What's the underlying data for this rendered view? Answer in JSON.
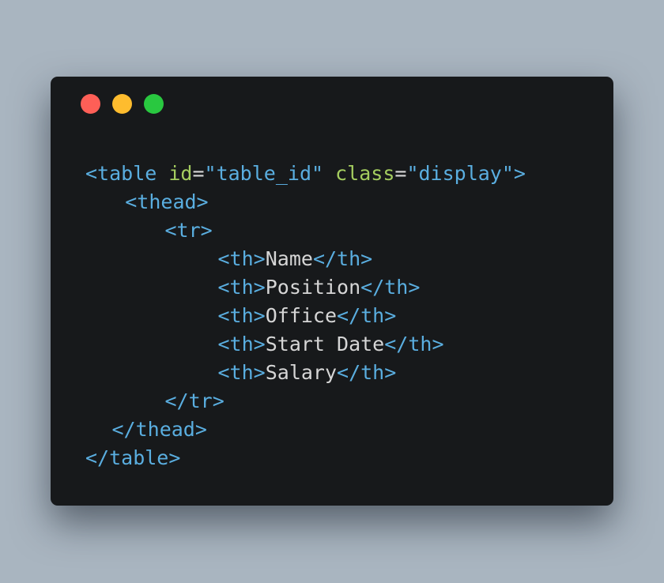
{
  "colors": {
    "close": "#fe5f57",
    "minimize": "#febc2e",
    "maximize": "#29c840",
    "tag": "#5aaee0",
    "attr": "#a4cd5f",
    "punct": "#d6d6d6",
    "string": "#5aaee0",
    "text": "#d6d6d6"
  },
  "code": {
    "lines": [
      {
        "indent": 0,
        "tokens": [
          {
            "t": "<table ",
            "c": "tag"
          },
          {
            "t": "id",
            "c": "attr"
          },
          {
            "t": "=",
            "c": "punct"
          },
          {
            "t": "\"table_id\"",
            "c": "string"
          },
          {
            "t": " ",
            "c": "text"
          },
          {
            "t": "class",
            "c": "attr"
          },
          {
            "t": "=",
            "c": "punct"
          },
          {
            "t": "\"display\"",
            "c": "string"
          },
          {
            "t": ">",
            "c": "tag"
          }
        ]
      },
      {
        "indent": 1.5,
        "tokens": [
          {
            "t": "<thead>",
            "c": "tag"
          }
        ]
      },
      {
        "indent": 3,
        "tokens": [
          {
            "t": "<tr>",
            "c": "tag"
          }
        ]
      },
      {
        "indent": 5,
        "tokens": [
          {
            "t": "<th>",
            "c": "tag"
          },
          {
            "t": "Name",
            "c": "text"
          },
          {
            "t": "</th>",
            "c": "tag"
          }
        ]
      },
      {
        "indent": 5,
        "tokens": [
          {
            "t": "<th>",
            "c": "tag"
          },
          {
            "t": "Position",
            "c": "text"
          },
          {
            "t": "</th>",
            "c": "tag"
          }
        ]
      },
      {
        "indent": 5,
        "tokens": [
          {
            "t": "<th>",
            "c": "tag"
          },
          {
            "t": "Office",
            "c": "text"
          },
          {
            "t": "</th>",
            "c": "tag"
          }
        ]
      },
      {
        "indent": 5,
        "tokens": [
          {
            "t": "<th>",
            "c": "tag"
          },
          {
            "t": "Start Date",
            "c": "text"
          },
          {
            "t": "</th>",
            "c": "tag"
          }
        ]
      },
      {
        "indent": 5,
        "tokens": [
          {
            "t": "<th>",
            "c": "tag"
          },
          {
            "t": "Salary",
            "c": "text"
          },
          {
            "t": "</th>",
            "c": "tag"
          }
        ]
      },
      {
        "indent": 3,
        "tokens": [
          {
            "t": "</tr>",
            "c": "tag"
          }
        ]
      },
      {
        "indent": 1,
        "tokens": [
          {
            "t": "</thead>",
            "c": "tag"
          }
        ]
      },
      {
        "indent": 0,
        "tokens": [
          {
            "t": "</table>",
            "c": "tag"
          }
        ]
      }
    ]
  }
}
